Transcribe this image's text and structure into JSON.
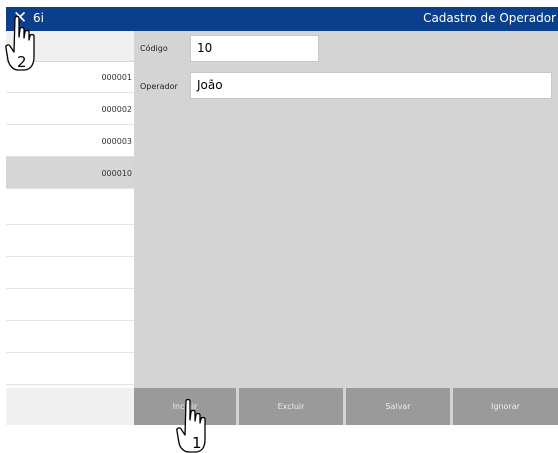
{
  "titlebar": {
    "app_name": "6i",
    "title": "Cadastro de Operador",
    "close_glyph": "✕"
  },
  "list": {
    "rows": [
      {
        "code": "000001"
      },
      {
        "code": "000002"
      },
      {
        "code": "000003"
      },
      {
        "code": "000010"
      }
    ]
  },
  "form": {
    "codigo": {
      "label": "Código",
      "value": "10"
    },
    "operador": {
      "label": "Operador",
      "value": "João"
    }
  },
  "toolbar": {
    "incluir": "Incluir",
    "excluir": "Excluir",
    "salvar": "Salvar",
    "ignorar": "Ignorar"
  },
  "annotations": {
    "pointer_1_label": "1",
    "pointer_2_label": "2"
  },
  "colors": {
    "title_bar": "#0b3f8c",
    "selected_row": "#d6d6d6",
    "form_bg": "#d4d4d4",
    "button_bg": "#9a9a9a"
  }
}
